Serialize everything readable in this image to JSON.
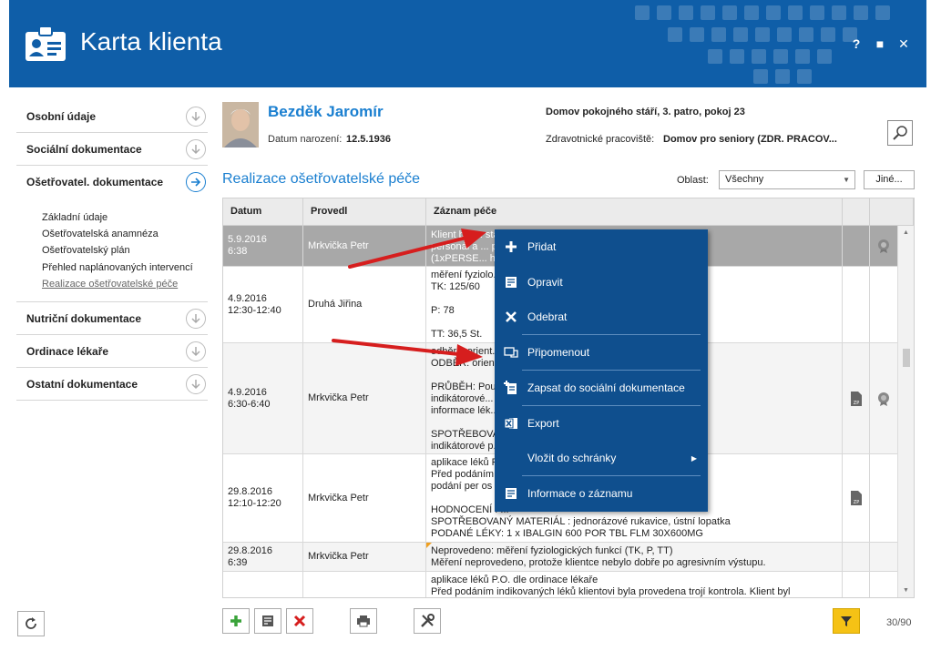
{
  "app": {
    "title": "Karta klienta",
    "help": "?",
    "maximize": "■",
    "close": "✕"
  },
  "sidebar": {
    "sections": [
      {
        "label": "Osobní údaje"
      },
      {
        "label": "Sociální dokumentace"
      },
      {
        "label": "Ošetřovatel. dokumentace"
      },
      {
        "label": "Nutriční dokumentace"
      },
      {
        "label": "Ordinace lékaře"
      },
      {
        "label": "Ostatní dokumentace"
      }
    ],
    "subitems": [
      {
        "label": "Základní údaje"
      },
      {
        "label": "Ošetřovatelská anamnéza"
      },
      {
        "label": "Ošetřovatelský plán"
      },
      {
        "label": "Přehled naplánovaných intervencí"
      },
      {
        "label": "Realizace ošetřovatelské péče"
      }
    ]
  },
  "patient": {
    "name": "Bezděk Jaromír",
    "dob_label": "Datum narození:",
    "dob": "12.5.1936",
    "home": "Domov pokojného stáří, 3. patro, pokoj 23",
    "zp_label": "Zdravotnické pracoviště:",
    "zp": "Domov pro seniory (ZDR. PRACOV..."
  },
  "section": {
    "title": "Realizace ošetřovatelské péče",
    "oblast_label": "Oblast:",
    "oblast_value": "Všechny",
    "other_button": "Jiné..."
  },
  "table": {
    "headers": [
      "Datum",
      "Provedl",
      "Záznam péče"
    ],
    "rows": [
      {
        "date": "5.9.2016",
        "time": "6:38",
        "by": "Mrkvička Petr",
        "lines": [
          "Klient byl ... stavu. Byl agresivní na",
          "personál a ... podány uklidňující léky",
          "(1xPERSE... hodinu."
        ]
      },
      {
        "date": "4.9.2016",
        "time": "12:30-12:40",
        "by": "Druhá Jiřina",
        "lines": [
          "měření fyziolo...",
          "TK: 125/60",
          "",
          "P: 78",
          "",
          "TT: 36,5 St."
        ]
      },
      {
        "date": "4.9.2016",
        "time": "6:30-6:40",
        "by": "Mrkvička Petr",
        "lines": [
          "odběr... orient...",
          "ODBĚR: orient...",
          "",
          "PRŮBĚH: Pouč... ěr vzorku moči, použití",
          "indikátorové... s do dokumentace, podání",
          "informace lék...",
          "",
          "SPOTŘEBOVAN... odběrová nádobka,",
          "indikátorové p..."
        ]
      },
      {
        "date": "29.8.2016",
        "time": "12:10-12:20",
        "by": "Mrkvička Petr",
        "lines": [
          "aplikace léků P...",
          "Před podáním ... rmován o podání léky. Po",
          "podání per os ...",
          "",
          "HODNOCENÍ : ...",
          "SPOTŘEBOVANÝ MATERIÁL : jednorázové rukavice, ústní lopatka",
          "PODANÉ LÉKY: 1 x IBALGIN 600 POR TBL FLM 30X600MG"
        ]
      },
      {
        "date": "29.8.2016",
        "time": "6:39",
        "by": "Mrkvička Petr",
        "lines": [
          "Neprovedeno: měření fyziologických funkcí (TK, P, TT)",
          "Měření neprovedeno, protože klientce nebylo dobře po agresivním výstupu."
        ]
      },
      {
        "date": "",
        "time": "",
        "by": "",
        "lines": [
          "aplikace léků P.O. dle ordinace lékaře",
          "Před podáním indikovaných léků klientovi byla provedena trojí kontrola. Klient byl"
        ]
      }
    ]
  },
  "context_menu": {
    "items": [
      {
        "label": "Přidat"
      },
      {
        "label": "Opravit"
      },
      {
        "label": "Odebrat"
      },
      {
        "label": "Připomenout"
      },
      {
        "label": "Zapsat do sociální dokumentace"
      },
      {
        "label": "Export"
      },
      {
        "label": "Vložit do schránky"
      },
      {
        "label": "Informace o záznamu"
      }
    ]
  },
  "footer": {
    "count": "30/90"
  },
  "colors": {
    "header": "#0f5ea8",
    "accent": "#1a7fd0",
    "menu": "#0f4f8e",
    "filter": "#f5c215"
  }
}
